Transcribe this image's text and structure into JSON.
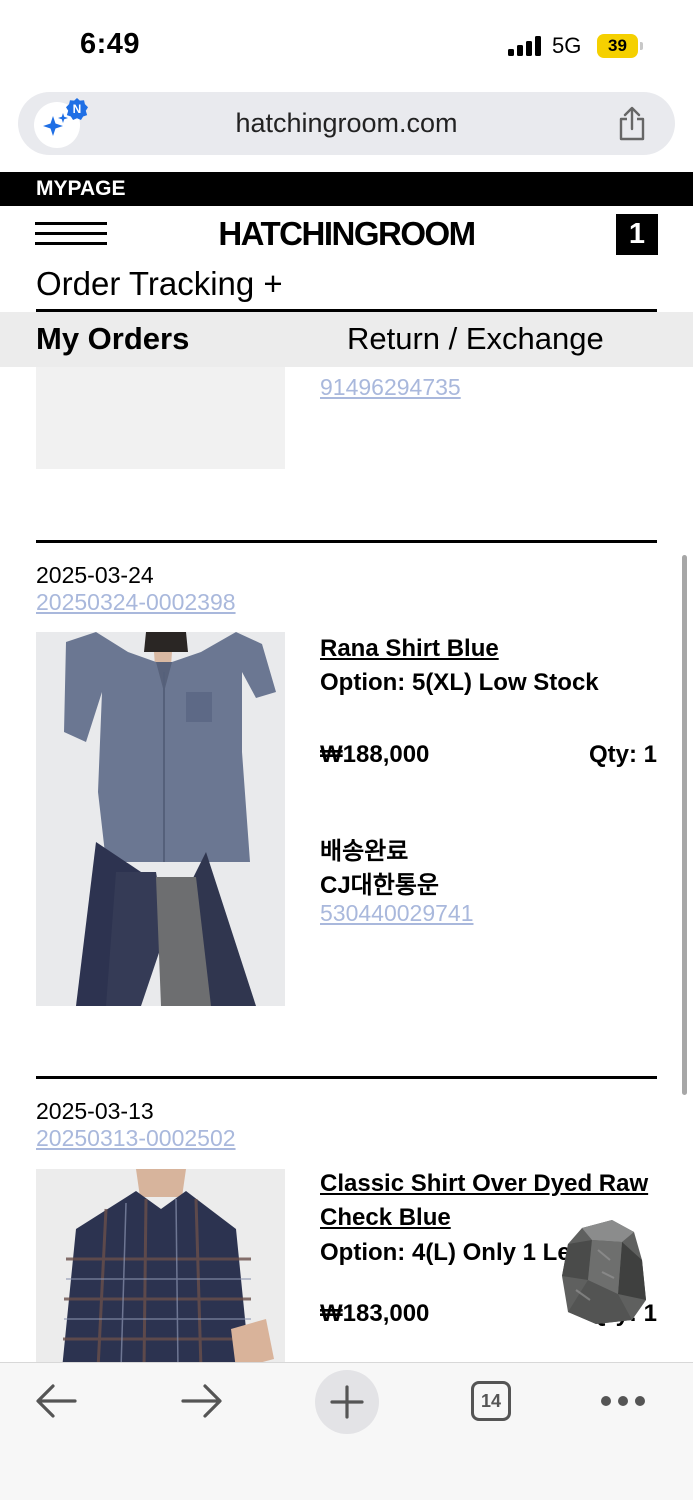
{
  "status_bar": {
    "time": "6:49",
    "network": "5G",
    "battery": "39"
  },
  "browser": {
    "url": "hatchingroom.com",
    "assistant_badge": "N",
    "tab_count": "14"
  },
  "header": {
    "mypage_label": "MYPAGE",
    "logo": "HATCHINGROOM",
    "cart_count": "1"
  },
  "page": {
    "title": "Order Tracking +"
  },
  "tabs": {
    "my_orders": "My Orders",
    "return_exchange": "Return / Exchange"
  },
  "previous_order": {
    "tracking_number": "91496294735"
  },
  "orders": [
    {
      "date": "2025-03-24",
      "order_number": "20250324-0002398",
      "product_name": "Rana Shirt Blue",
      "option": "Option: 5(XL) Low Stock",
      "price": "₩188,000",
      "qty": "Qty: 1",
      "status": "배송완료",
      "carrier": "CJ대한통운",
      "tracking_number": "530440029741"
    },
    {
      "date": "2025-03-13",
      "order_number": "20250313-0002502",
      "product_name": "Classic Shirt Over Dyed Raw Check Blue",
      "option": "Option: 4(L) Only 1 Le",
      "price": "₩183,000",
      "qty": "Qty: 1"
    }
  ],
  "colors": {
    "link": "#a9b8dc",
    "battery": "#f5d000",
    "tab_bar": "#ececec",
    "assistant_badge": "#1f6fe5"
  },
  "icons": [
    "assistant-sparkle-icon",
    "share-icon",
    "hamburger-menu-icon",
    "back-arrow-icon",
    "forward-arrow-icon",
    "plus-icon",
    "tabs-icon",
    "more-icon"
  ]
}
